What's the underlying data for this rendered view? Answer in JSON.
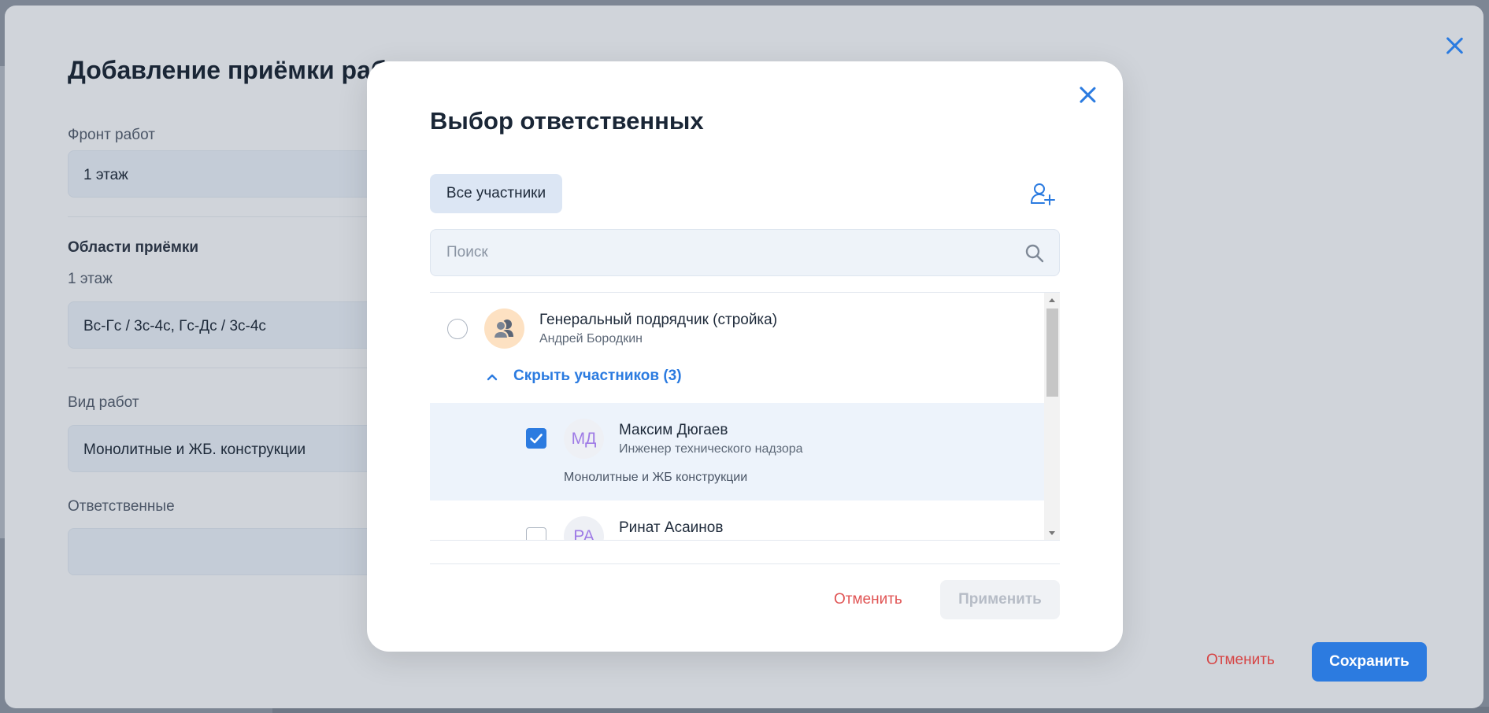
{
  "drawer": {
    "title": "Добавление приёмки раб",
    "fields": {
      "front_label": "Фронт работ",
      "front_value": "1 этаж",
      "areas_label": "Области приёмки",
      "areas_sublabel": "1 этаж",
      "areas_value": "Вс-Гс / 3с-4с, Гс-Дс / 3с-4с",
      "work_type_label": "Вид работ",
      "work_type_value": "Монолитные и ЖБ. конструкции",
      "responsible_label": "Ответственные",
      "responsible_value": ""
    },
    "cancel_label": "Отменить",
    "save_label": "Сохранить"
  },
  "modal": {
    "title": "Выбор ответственных",
    "tab_label": "Все участники",
    "search": {
      "placeholder": "Поиск",
      "value": ""
    },
    "group": {
      "name": "Генеральный подрядчик (стройка)",
      "contact": "Андрей Бородкин",
      "toggle_label": "Скрыть участников (3)"
    },
    "members": [
      {
        "initials": "МД",
        "name": "Максим Дюгаев",
        "role": "Инженер технического надзора",
        "specialization": "Монолитные и ЖБ конструкции",
        "checked": true
      },
      {
        "initials": "РА",
        "name": "Ринат Асаинов",
        "checked": false
      }
    ],
    "cancel_label": "Отменить",
    "apply_label": "Применить"
  },
  "colors": {
    "accent": "#2c7be0",
    "danger": "#e05454",
    "avatar_initials": "#9f7be6",
    "group_avatar_bg": "#fde1c2"
  },
  "icons": {
    "drawer_close": "close-icon",
    "modal_close": "close-icon",
    "add_user": "add-user-icon",
    "search": "search-icon",
    "group_avatar": "users-group-icon",
    "toggle": "chevron-up-icon",
    "checkbox_checked": "check-icon"
  }
}
